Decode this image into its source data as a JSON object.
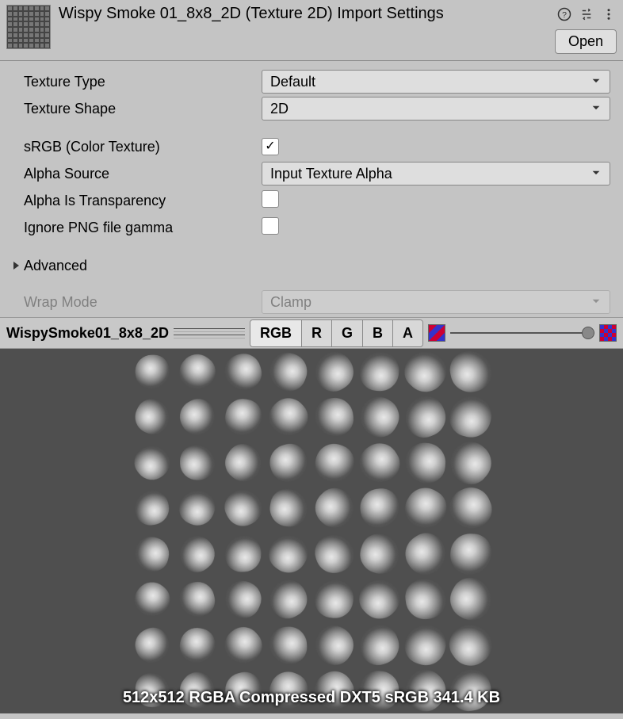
{
  "header": {
    "title": "Wispy Smoke 01_8x8_2D (Texture 2D) Import Settings",
    "open_label": "Open",
    "help_icon": "help-icon",
    "settings_icon": "settings-icon",
    "menu_icon": "menu-icon"
  },
  "form": {
    "texture_type": {
      "label": "Texture Type",
      "value": "Default"
    },
    "texture_shape": {
      "label": "Texture Shape",
      "value": "2D"
    },
    "srgb": {
      "label": "sRGB (Color Texture)",
      "checked": true
    },
    "alpha_source": {
      "label": "Alpha Source",
      "value": "Input Texture Alpha"
    },
    "alpha_is_transparency": {
      "label": "Alpha Is Transparency",
      "checked": false
    },
    "ignore_png_gamma": {
      "label": "Ignore PNG file gamma",
      "checked": false
    },
    "advanced": {
      "label": "Advanced"
    },
    "wrap_mode": {
      "label": "Wrap Mode",
      "value": "Clamp"
    }
  },
  "preview": {
    "asset_name": "WispySmoke01_8x8_2D",
    "channels": {
      "rgb": "RGB",
      "r": "R",
      "g": "G",
      "b": "B",
      "a": "A"
    },
    "footer": "512x512 RGBA Compressed DXT5 sRGB  341.4 KB"
  }
}
